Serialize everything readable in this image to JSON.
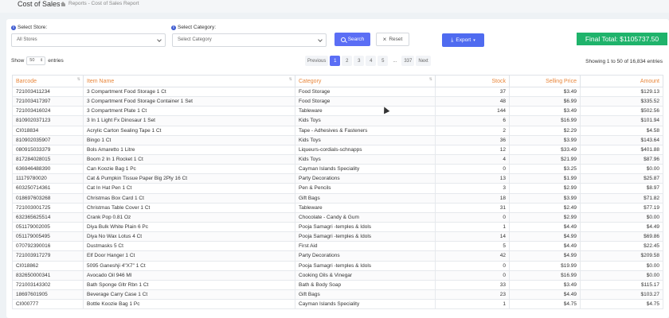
{
  "header": {
    "title": "Cost of Sales",
    "breadcrumb": "Reports - Cost of Sales Report"
  },
  "filters": {
    "store_label": "Select Store:",
    "store_value": "All Stores",
    "category_label": "Select Category:",
    "category_placeholder": "Select Category",
    "search_label": "Search",
    "reset_label": "Reset",
    "export_label": "Export"
  },
  "final_total": "Final Total: $1105737.50",
  "table_controls": {
    "show_label": "Show",
    "page_size": "50",
    "entries_label": "entries",
    "pages": [
      "Previous",
      "1",
      "2",
      "3",
      "4",
      "5",
      "...",
      "337",
      "Next"
    ],
    "active_page": "1",
    "showing_text": "Showing 1 to 50 of 16,834 entries"
  },
  "columns": [
    "Barcode",
    "Item Name",
    "Category",
    "Stock",
    "Selling Price",
    "Amount"
  ],
  "rows": [
    [
      "721003411234",
      "3 Compartment Food Storage 1 Ct",
      "Food Storage",
      "37",
      "$3.49",
      "$129.13"
    ],
    [
      "721003417397",
      "3 Compartment Food Storage Container 1 Set",
      "Food Storage",
      "48",
      "$6.99",
      "$335.52"
    ],
    [
      "721003416024",
      "3 Compartment Plate 1 Ct",
      "Tableware",
      "144",
      "$3.49",
      "$502.56"
    ],
    [
      "810902037123",
      "3 In 1 Light Fx Dinosaur 1 Set",
      "Kids Toys",
      "6",
      "$16.99",
      "$101.94"
    ],
    [
      "CI018834",
      "Acrylic Carton Sealing Tape 1 Ct",
      "Tape - Adhesives & Fasteners",
      "2",
      "$2.29",
      "$4.58"
    ],
    [
      "810902035907",
      "Bingo 1 Ct",
      "Kids Toys",
      "36",
      "$3.99",
      "$143.64"
    ],
    [
      "080915033379",
      "Bols Amaretto 1 Litre",
      "Liqueurs-cordials-schnapps",
      "12",
      "$33.49",
      "$401.88"
    ],
    [
      "817284028015",
      "Boom 2 In 1 Rocket 1 Ct",
      "Kids Toys",
      "4",
      "$21.99",
      "$87.96"
    ],
    [
      "636946488390",
      "Can Koozie Bag 1 Pc",
      "Cayman Islands Speciality",
      "0",
      "$3.25",
      "$0.00"
    ],
    [
      "11179780020",
      "Cat & Pumpkin Tissue Paper Big 2Ply 16 Ct",
      "Party Decorations",
      "13",
      "$1.99",
      "$25.87"
    ],
    [
      "603250714361",
      "Cat In Hat Pen 1 Ct",
      "Pen & Pencils",
      "3",
      "$2.99",
      "$8.97"
    ],
    [
      "018697603268",
      "Christmas Box Card 1 Ct",
      "Gift Bags",
      "18",
      "$3.99",
      "$71.82"
    ],
    [
      "721003001725",
      "Christmas Table Cover 1 Ct",
      "Tableware",
      "31",
      "$2.49",
      "$77.19"
    ],
    [
      "632365625514",
      "Crank Pop 0.81 Oz",
      "Chocolate - Candy & Gum",
      "0",
      "$2.99",
      "$0.00"
    ],
    [
      "051179002005",
      "Diya Bulk White Plain 6 Pc",
      "Pooja Samagri -temples & Idols",
      "1",
      "$4.49",
      "$4.49"
    ],
    [
      "051179005495",
      "Diya No Wax Lotus 4 Ct",
      "Pooja Samagri -temples & Idols",
      "14",
      "$4.99",
      "$69.86"
    ],
    [
      "070792390016",
      "Dustmasks 5 Ct",
      "First Aid",
      "5",
      "$4.49",
      "$22.45"
    ],
    [
      "721003917279",
      "Elf Door Hanger 1 Ct",
      "Party Decorations",
      "42",
      "$4.99",
      "$209.58"
    ],
    [
      "CI018862",
      "5095 Ganeshji 4\"X7\" 1 Ct",
      "Pooja Samagri -temples & Idols",
      "0",
      "$19.99",
      "$0.00"
    ],
    [
      "832650000341",
      "Avocado Oil 946 Ml",
      "Cooking Oils & Vinegar",
      "0",
      "$16.99",
      "$0.00"
    ],
    [
      "721003143302",
      "Bath Sponge Gltr Rbn 1 Ct",
      "Bath & Body Soap",
      "33",
      "$3.49",
      "$115.17"
    ],
    [
      "18697601905",
      "Beverage Carry Case 1 Ct",
      "Gift Bags",
      "23",
      "$4.49",
      "$103.27"
    ],
    [
      "CI000777",
      "Bottle Koozie Bag 1 Pc",
      "Cayman Islands Speciality",
      "1",
      "$4.75",
      "$4.75"
    ]
  ]
}
